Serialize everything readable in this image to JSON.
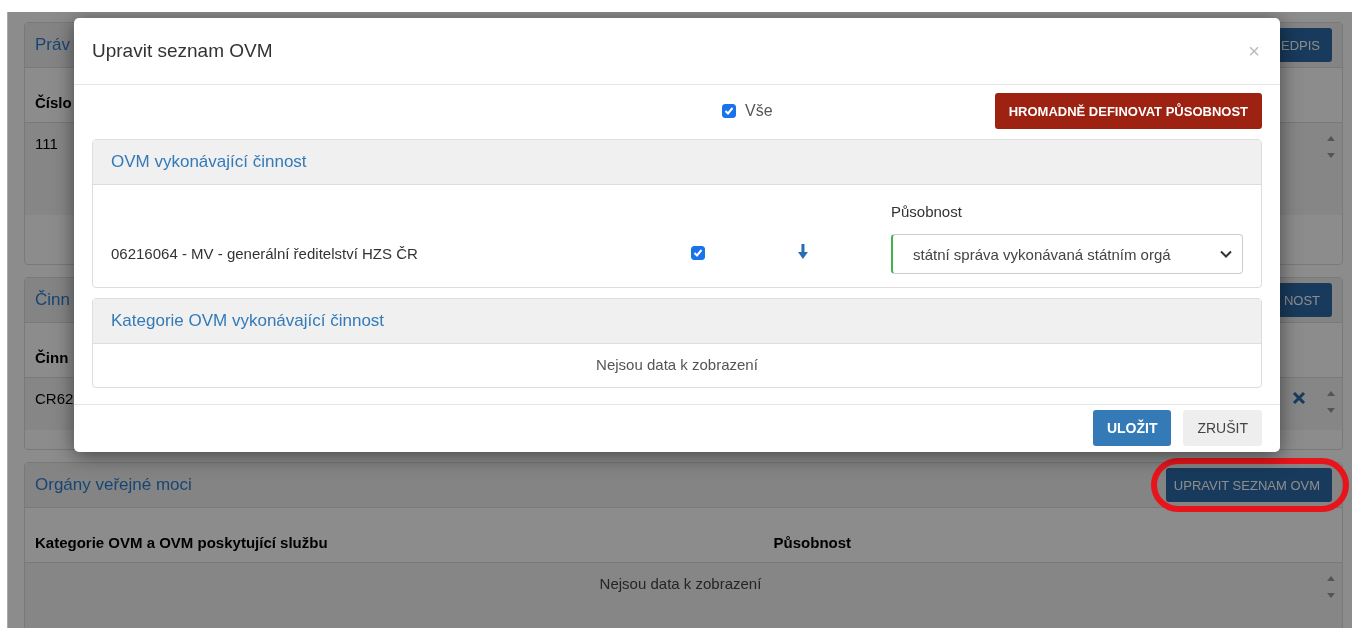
{
  "page": {
    "panels": [
      {
        "title": "Práv",
        "action": "EDPIS",
        "columns": [
          "Číslo"
        ],
        "rows": [
          {
            "cells": [
              "111"
            ],
            "removable": false
          }
        ]
      },
      {
        "title": "Činn",
        "action": "NOST",
        "columns": [
          "Činn"
        ],
        "rows": [
          {
            "cells": [
              "CR62"
            ],
            "removable": true
          }
        ]
      },
      {
        "title": "Orgány veřejné moci",
        "action": "UPRAVIT SEZNAM OVM",
        "highlighted": true,
        "columns": [
          "Kategorie OVM a OVM poskytující službu",
          "Působnost"
        ],
        "empty_text": "Nejsou data k zobrazení"
      }
    ]
  },
  "dialog": {
    "title": "Upravit seznam OVM",
    "close": "×",
    "select_all": {
      "label": "Vše",
      "checked": true
    },
    "bulk_button": "HROMADNĚ DEFINOVAT PŮSOBNOST",
    "sections": [
      {
        "title": "OVM vykonávající činnost",
        "field_label": "Působnost",
        "rows": [
          {
            "name": "06216064 - MV - generální ředitelství HZS ČR",
            "checked": true,
            "value": "státní správa vykonávaná státním orgá"
          }
        ]
      },
      {
        "title": "Kategorie OVM vykonávající činnost",
        "empty_text": "Nejsou data k zobrazení"
      }
    ],
    "buttons": [
      {
        "label": "ULOŽIT",
        "kind": "primary"
      },
      {
        "label": "ZRUŠIT",
        "kind": "default"
      }
    ]
  }
}
